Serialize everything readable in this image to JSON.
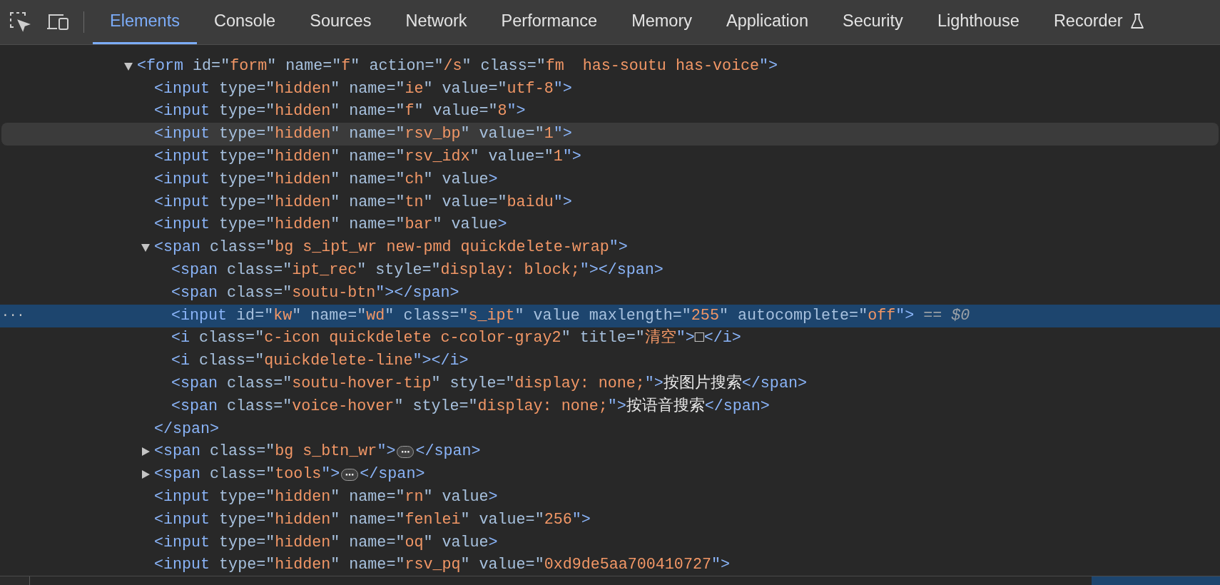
{
  "toolbar": {
    "tabs": [
      {
        "label": "Elements",
        "selected": true
      },
      {
        "label": "Console",
        "selected": false
      },
      {
        "label": "Sources",
        "selected": false
      },
      {
        "label": "Network",
        "selected": false
      },
      {
        "label": "Performance",
        "selected": false
      },
      {
        "label": "Memory",
        "selected": false
      },
      {
        "label": "Application",
        "selected": false
      },
      {
        "label": "Security",
        "selected": false
      },
      {
        "label": "Lighthouse",
        "selected": false
      },
      {
        "label": "Recorder",
        "selected": false,
        "kind": "experimental"
      }
    ]
  },
  "tree": {
    "nodes": [
      {
        "expanded": true,
        "selected": false,
        "hovered": false,
        "tokens": [
          {
            "kind": "tag",
            "text": "<form"
          },
          {
            "kind": "attr",
            "text": " id=\""
          },
          {
            "kind": "value",
            "text": "form"
          },
          {
            "kind": "attr",
            "text": "\" name=\""
          },
          {
            "kind": "value",
            "text": "f"
          },
          {
            "kind": "attr",
            "text": "\" action=\""
          },
          {
            "kind": "value",
            "text": "/s"
          },
          {
            "kind": "attr",
            "text": "\" class=\""
          },
          {
            "kind": "value",
            "text": "fm  has-soutu has-voice"
          },
          {
            "kind": "tag",
            "text": "\">"
          }
        ],
        "children": [
          {
            "selected": false,
            "hovered": false,
            "tokens": [
              {
                "kind": "tag",
                "text": "<input"
              },
              {
                "kind": "attr",
                "text": " type=\""
              },
              {
                "kind": "value",
                "text": "hidden"
              },
              {
                "kind": "attr",
                "text": "\" name=\""
              },
              {
                "kind": "value",
                "text": "ie"
              },
              {
                "kind": "attr",
                "text": "\" value=\""
              },
              {
                "kind": "value",
                "text": "utf-8"
              },
              {
                "kind": "tag",
                "text": "\">"
              }
            ]
          },
          {
            "selected": false,
            "hovered": false,
            "tokens": [
              {
                "kind": "tag",
                "text": "<input"
              },
              {
                "kind": "attr",
                "text": " type=\""
              },
              {
                "kind": "value",
                "text": "hidden"
              },
              {
                "kind": "attr",
                "text": "\" name=\""
              },
              {
                "kind": "value",
                "text": "f"
              },
              {
                "kind": "attr",
                "text": "\" value=\""
              },
              {
                "kind": "value",
                "text": "8"
              },
              {
                "kind": "tag",
                "text": "\">"
              }
            ]
          },
          {
            "selected": false,
            "hovered": true,
            "tokens": [
              {
                "kind": "tag",
                "text": "<input"
              },
              {
                "kind": "attr",
                "text": " type=\""
              },
              {
                "kind": "value",
                "text": "hidden"
              },
              {
                "kind": "attr",
                "text": "\" name=\""
              },
              {
                "kind": "value",
                "text": "rsv_bp"
              },
              {
                "kind": "attr",
                "text": "\" value=\""
              },
              {
                "kind": "value",
                "text": "1"
              },
              {
                "kind": "tag",
                "text": "\">"
              }
            ]
          },
          {
            "selected": false,
            "hovered": false,
            "tokens": [
              {
                "kind": "tag",
                "text": "<input"
              },
              {
                "kind": "attr",
                "text": " type=\""
              },
              {
                "kind": "value",
                "text": "hidden"
              },
              {
                "kind": "attr",
                "text": "\" name=\""
              },
              {
                "kind": "value",
                "text": "rsv_idx"
              },
              {
                "kind": "attr",
                "text": "\" value=\""
              },
              {
                "kind": "value",
                "text": "1"
              },
              {
                "kind": "tag",
                "text": "\">"
              }
            ]
          },
          {
            "selected": false,
            "hovered": false,
            "tokens": [
              {
                "kind": "tag",
                "text": "<input"
              },
              {
                "kind": "attr",
                "text": " type=\""
              },
              {
                "kind": "value",
                "text": "hidden"
              },
              {
                "kind": "attr",
                "text": "\" name=\""
              },
              {
                "kind": "value",
                "text": "ch"
              },
              {
                "kind": "attr",
                "text": "\" value"
              },
              {
                "kind": "tag",
                "text": ">"
              }
            ]
          },
          {
            "selected": false,
            "hovered": false,
            "tokens": [
              {
                "kind": "tag",
                "text": "<input"
              },
              {
                "kind": "attr",
                "text": " type=\""
              },
              {
                "kind": "value",
                "text": "hidden"
              },
              {
                "kind": "attr",
                "text": "\" name=\""
              },
              {
                "kind": "value",
                "text": "tn"
              },
              {
                "kind": "attr",
                "text": "\" value=\""
              },
              {
                "kind": "value",
                "text": "baidu"
              },
              {
                "kind": "tag",
                "text": "\">"
              }
            ]
          },
          {
            "selected": false,
            "hovered": false,
            "tokens": [
              {
                "kind": "tag",
                "text": "<input"
              },
              {
                "kind": "attr",
                "text": " type=\""
              },
              {
                "kind": "value",
                "text": "hidden"
              },
              {
                "kind": "attr",
                "text": "\" name=\""
              },
              {
                "kind": "value",
                "text": "bar"
              },
              {
                "kind": "attr",
                "text": "\" value"
              },
              {
                "kind": "tag",
                "text": ">"
              }
            ]
          },
          {
            "expanded": true,
            "selected": false,
            "hovered": false,
            "tokens": [
              {
                "kind": "tag",
                "text": "<span"
              },
              {
                "kind": "attr",
                "text": " class=\""
              },
              {
                "kind": "value",
                "text": "bg s_ipt_wr new-pmd quickdelete-wrap"
              },
              {
                "kind": "tag",
                "text": "\">"
              }
            ],
            "close": [
              {
                "kind": "tag",
                "text": "</span>"
              }
            ],
            "children": [
              {
                "selected": false,
                "hovered": false,
                "tokens": [
                  {
                    "kind": "tag",
                    "text": "<span"
                  },
                  {
                    "kind": "attr",
                    "text": " class=\""
                  },
                  {
                    "kind": "value",
                    "text": "ipt_rec"
                  },
                  {
                    "kind": "attr",
                    "text": "\" style=\""
                  },
                  {
                    "kind": "value",
                    "text": "display: block;"
                  },
                  {
                    "kind": "tag",
                    "text": "\"></span>"
                  }
                ]
              },
              {
                "selected": false,
                "hovered": false,
                "tokens": [
                  {
                    "kind": "tag",
                    "text": "<span"
                  },
                  {
                    "kind": "attr",
                    "text": " class=\""
                  },
                  {
                    "kind": "value",
                    "text": "soutu-btn"
                  },
                  {
                    "kind": "tag",
                    "text": "\"></span>"
                  }
                ]
              },
              {
                "selected": true,
                "hovered": false,
                "menu": "···",
                "tokens": [
                  {
                    "kind": "tag",
                    "text": "<input"
                  },
                  {
                    "kind": "attr",
                    "text": " id=\""
                  },
                  {
                    "kind": "value",
                    "text": "kw"
                  },
                  {
                    "kind": "attr",
                    "text": "\" name=\""
                  },
                  {
                    "kind": "value",
                    "text": "wd"
                  },
                  {
                    "kind": "attr",
                    "text": "\" class=\""
                  },
                  {
                    "kind": "value",
                    "text": "s_ipt"
                  },
                  {
                    "kind": "attr",
                    "text": "\" value maxlength=\""
                  },
                  {
                    "kind": "value",
                    "text": "255"
                  },
                  {
                    "kind": "attr",
                    "text": "\" autocomplete=\""
                  },
                  {
                    "kind": "value",
                    "text": "off"
                  },
                  {
                    "kind": "tag",
                    "text": "\">"
                  },
                  {
                    "kind": "marker",
                    "text": " == $0"
                  }
                ]
              },
              {
                "selected": false,
                "hovered": false,
                "tokens": [
                  {
                    "kind": "tag",
                    "text": "<i"
                  },
                  {
                    "kind": "attr",
                    "text": " class=\""
                  },
                  {
                    "kind": "value",
                    "text": "c-icon quickdelete c-color-gray2"
                  },
                  {
                    "kind": "attr",
                    "text": "\" title=\""
                  },
                  {
                    "kind": "value",
                    "text": "清空"
                  },
                  {
                    "kind": "tag",
                    "text": "\">"
                  },
                  {
                    "kind": "text",
                    "text": "□"
                  },
                  {
                    "kind": "tag",
                    "text": "</i>"
                  }
                ]
              },
              {
                "selected": false,
                "hovered": false,
                "tokens": [
                  {
                    "kind": "tag",
                    "text": "<i"
                  },
                  {
                    "kind": "attr",
                    "text": " class=\""
                  },
                  {
                    "kind": "value",
                    "text": "quickdelete-line"
                  },
                  {
                    "kind": "tag",
                    "text": "\"></i>"
                  }
                ]
              },
              {
                "selected": false,
                "hovered": false,
                "tokens": [
                  {
                    "kind": "tag",
                    "text": "<span"
                  },
                  {
                    "kind": "attr",
                    "text": " class=\""
                  },
                  {
                    "kind": "value",
                    "text": "soutu-hover-tip"
                  },
                  {
                    "kind": "attr",
                    "text": "\" style=\""
                  },
                  {
                    "kind": "value",
                    "text": "display: none;"
                  },
                  {
                    "kind": "tag",
                    "text": "\">"
                  },
                  {
                    "kind": "text",
                    "text": "按图片搜索"
                  },
                  {
                    "kind": "tag",
                    "text": "</span>"
                  }
                ]
              },
              {
                "selected": false,
                "hovered": false,
                "tokens": [
                  {
                    "kind": "tag",
                    "text": "<span"
                  },
                  {
                    "kind": "attr",
                    "text": " class=\""
                  },
                  {
                    "kind": "value",
                    "text": "voice-hover"
                  },
                  {
                    "kind": "attr",
                    "text": "\" style=\""
                  },
                  {
                    "kind": "value",
                    "text": "display: none;"
                  },
                  {
                    "kind": "tag",
                    "text": "\">"
                  },
                  {
                    "kind": "text",
                    "text": "按语音搜索"
                  },
                  {
                    "kind": "tag",
                    "text": "</span>"
                  }
                ]
              }
            ]
          },
          {
            "expanded": false,
            "selected": false,
            "hovered": false,
            "tokens": [
              {
                "kind": "tag",
                "text": "<span"
              },
              {
                "kind": "attr",
                "text": " class=\""
              },
              {
                "kind": "value",
                "text": "bg s_btn_wr"
              },
              {
                "kind": "tag",
                "text": "\">"
              },
              {
                "kind": "ellipsis",
                "text": "⋯"
              },
              {
                "kind": "tag",
                "text": "</span>"
              }
            ]
          },
          {
            "expanded": false,
            "selected": false,
            "hovered": false,
            "tokens": [
              {
                "kind": "tag",
                "text": "<span"
              },
              {
                "kind": "attr",
                "text": " class=\""
              },
              {
                "kind": "value",
                "text": "tools"
              },
              {
                "kind": "tag",
                "text": "\">"
              },
              {
                "kind": "ellipsis",
                "text": "⋯"
              },
              {
                "kind": "tag",
                "text": "</span>"
              }
            ]
          },
          {
            "selected": false,
            "hovered": false,
            "tokens": [
              {
                "kind": "tag",
                "text": "<input"
              },
              {
                "kind": "attr",
                "text": " type=\""
              },
              {
                "kind": "value",
                "text": "hidden"
              },
              {
                "kind": "attr",
                "text": "\" name=\""
              },
              {
                "kind": "value",
                "text": "rn"
              },
              {
                "kind": "attr",
                "text": "\" value"
              },
              {
                "kind": "tag",
                "text": ">"
              }
            ]
          },
          {
            "selected": false,
            "hovered": false,
            "tokens": [
              {
                "kind": "tag",
                "text": "<input"
              },
              {
                "kind": "attr",
                "text": " type=\""
              },
              {
                "kind": "value",
                "text": "hidden"
              },
              {
                "kind": "attr",
                "text": "\" name=\""
              },
              {
                "kind": "value",
                "text": "fenlei"
              },
              {
                "kind": "attr",
                "text": "\" value=\""
              },
              {
                "kind": "value",
                "text": "256"
              },
              {
                "kind": "tag",
                "text": "\">"
              }
            ]
          },
          {
            "selected": false,
            "hovered": false,
            "tokens": [
              {
                "kind": "tag",
                "text": "<input"
              },
              {
                "kind": "attr",
                "text": " type=\""
              },
              {
                "kind": "value",
                "text": "hidden"
              },
              {
                "kind": "attr",
                "text": "\" name=\""
              },
              {
                "kind": "value",
                "text": "oq"
              },
              {
                "kind": "attr",
                "text": "\" value"
              },
              {
                "kind": "tag",
                "text": ">"
              }
            ]
          },
          {
            "selected": false,
            "hovered": false,
            "tokens": [
              {
                "kind": "tag",
                "text": "<input"
              },
              {
                "kind": "attr",
                "text": " type=\""
              },
              {
                "kind": "value",
                "text": "hidden"
              },
              {
                "kind": "attr",
                "text": "\" name=\""
              },
              {
                "kind": "value",
                "text": "rsv_pq"
              },
              {
                "kind": "attr",
                "text": "\" value=\""
              },
              {
                "kind": "value",
                "text": "0xd9de5aa700410727"
              },
              {
                "kind": "tag",
                "text": "\">"
              }
            ]
          }
        ]
      }
    ]
  }
}
